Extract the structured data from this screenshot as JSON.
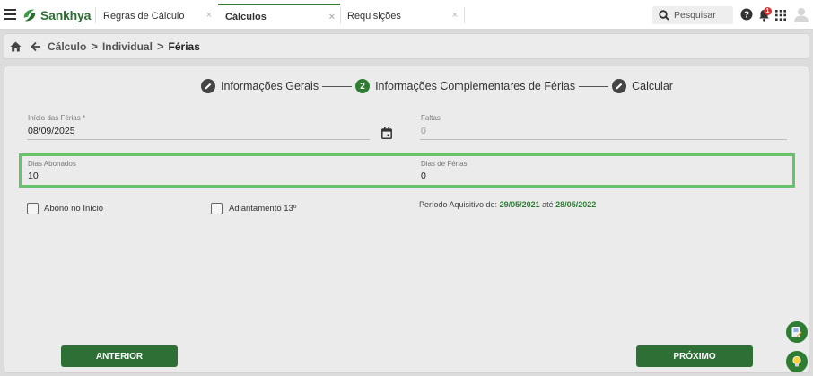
{
  "app": {
    "brand": "Sankhya"
  },
  "tabs": [
    {
      "label": "Regras de Cálculo",
      "close": "×",
      "active": false
    },
    {
      "label": "Cálculos",
      "close": "×",
      "active": true
    },
    {
      "label": "Requisições",
      "close": "×",
      "active": false
    }
  ],
  "search": {
    "placeholder": "Pesquisar"
  },
  "notifications": {
    "count": "1"
  },
  "breadcrumb": {
    "items": [
      "Cálculo",
      "Individual",
      "Férias"
    ]
  },
  "stepper": {
    "steps": [
      {
        "label": "Informações Gerais",
        "marker": "edit-icon"
      },
      {
        "label": "Informações Complementares de Férias",
        "marker": "2"
      },
      {
        "label": "Calcular",
        "marker": "edit-icon"
      }
    ]
  },
  "form": {
    "inicio_ferias": {
      "label": "Início das Férias *",
      "value": "08/09/2025"
    },
    "faltas": {
      "label": "Faltas",
      "value": "0"
    },
    "dias_abonados": {
      "label": "Dias Abonados",
      "value": "10"
    },
    "dias_ferias": {
      "label": "Dias de Férias",
      "value": "0"
    },
    "abono_inicio": {
      "label": "Abono no Início",
      "checked": false
    },
    "adiantamento_13": {
      "label": "Adiantamento 13º",
      "checked": false
    },
    "periodo": {
      "prefix": "Período Aquisitivo de:",
      "start": "29/05/2021",
      "mid": "até",
      "end": "28/05/2022"
    }
  },
  "buttons": {
    "anterior": "ANTERIOR",
    "proximo": "PRÓXIMO"
  },
  "colors": {
    "primary": "#2e7d32",
    "highlight": "#66c36a",
    "badge": "#d32f2f"
  }
}
